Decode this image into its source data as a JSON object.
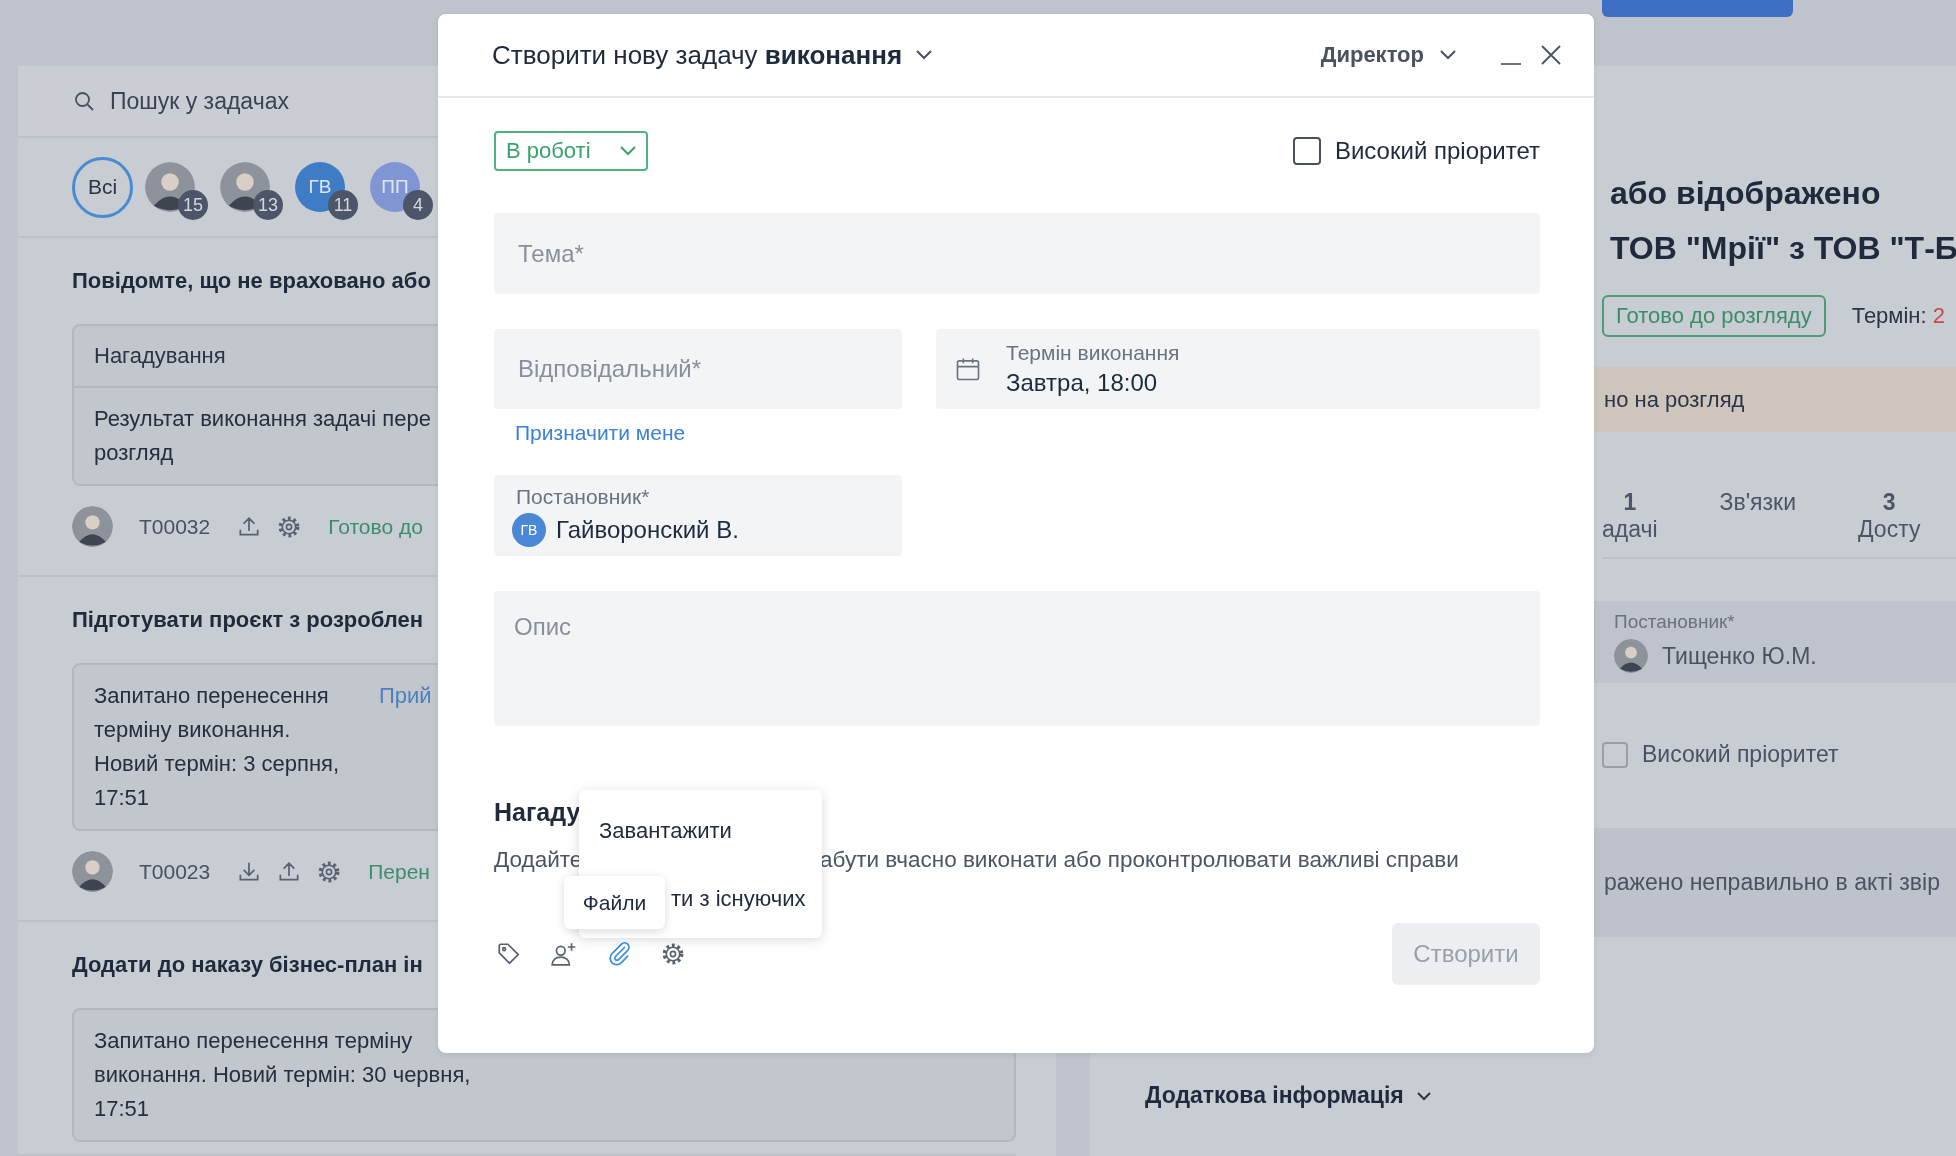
{
  "search": {
    "placeholder": "Пошук у задачах"
  },
  "assignee_filter": [
    {
      "kind": "all",
      "label": "Всі",
      "selected": true
    },
    {
      "kind": "photo",
      "count": "15",
      "selected": false
    },
    {
      "kind": "photo",
      "count": "13",
      "selected": false
    },
    {
      "kind": "initials",
      "label": "ГВ",
      "count": "11",
      "color": "#3f7cc6",
      "selected": false
    },
    {
      "kind": "initials",
      "label": "ПП",
      "count": "4",
      "color": "#8096d4",
      "selected": false
    }
  ],
  "tasks": [
    {
      "title": "Повідомте, що не враховано або",
      "card": {
        "header": "Нагадування",
        "lines": [
          "Результат виконання задачі пере",
          "розгляд"
        ]
      },
      "meta": {
        "code": "T00032",
        "actions": [
          {
            "kind": "upload"
          },
          {
            "kind": "settings"
          }
        ],
        "status": "Готово до"
      }
    },
    {
      "title": "Підготувати проєкт з розроблен",
      "card": {
        "lines": [
          "Запитано перенесення",
          "терміну виконання.",
          "Новий термін: 3 серпня,",
          "17:51"
        ],
        "link": "Прий"
      },
      "meta": {
        "code": "T00023",
        "actions": [
          {
            "kind": "download"
          },
          {
            "kind": "upload"
          },
          {
            "kind": "settings"
          }
        ],
        "status": "Перен"
      }
    },
    {
      "title": "Додати до наказу бізнес-план ін",
      "card": {
        "lines": [
          "Запитано перенесення терміну",
          "виконання. Новий термін: 30 червня,",
          "17:51"
        ]
      }
    }
  ],
  "detail": {
    "title_lines": [
      "або відображено",
      "ТОВ \"Мрії\" з ТОВ \"Т-Б"
    ],
    "status": "Готово до розгляду",
    "deadline_label": "Термін:",
    "deadline_value": "2",
    "banner": "но на розгляд",
    "tabs": [
      {
        "count": "1",
        "label": "адачі"
      },
      {
        "label": "Зв'язки"
      },
      {
        "count": "3",
        "label": "Досту"
      }
    ],
    "assigner": {
      "label": "Постановник*",
      "name": "Тищенко Ю.М."
    },
    "high_priority": {
      "label": "Високий пріоритет",
      "checked": false
    },
    "note": "ражено неправильно в акті звір",
    "more": "Додаткова інформація"
  },
  "modal": {
    "title": "Створити нову задачу **виконання**",
    "role": "Директор",
    "status": "В роботі",
    "high_priority": {
      "label": "Високий пріоритет",
      "checked": false
    },
    "subject": {
      "placeholder": "Тема*"
    },
    "responsible": {
      "placeholder": "Відповідальний*"
    },
    "deadline": {
      "label": "Термін виконання",
      "value": "Завтра, 18:00"
    },
    "assign_me": "Призначити мене",
    "assigner": {
      "label": "Постановник*",
      "initials": "ГВ",
      "name": "Гайворонский В."
    },
    "description": {
      "placeholder": "Опис"
    },
    "reminders": {
      "title": "Нагаду",
      "hint_start": "Додайте",
      "hint_end": "абути вчасно виконати або проконтролювати важливі справи"
    },
    "attach_menu": [
      "Завантажити",
      "ти з існуючих"
    ],
    "tooltip": "Файли",
    "tools": [
      {
        "kind": "tag",
        "selected": false
      },
      {
        "kind": "add-user",
        "selected": false
      },
      {
        "kind": "attach",
        "selected": true
      },
      {
        "kind": "settings",
        "selected": false
      }
    ],
    "submit": {
      "label": "Створити",
      "disabled": true
    }
  }
}
